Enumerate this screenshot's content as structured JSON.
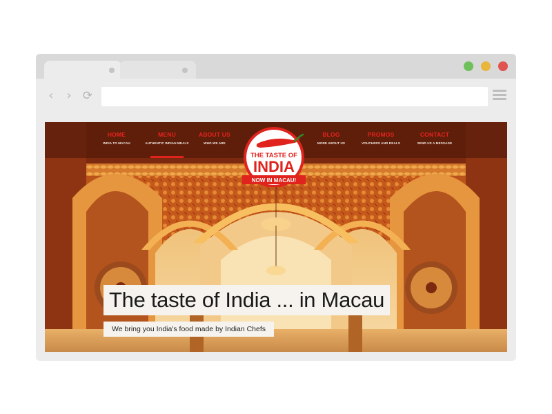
{
  "site": {
    "nav": [
      {
        "label": "HOME",
        "sub": "INDIA TO MACAU"
      },
      {
        "label": "MENU",
        "sub": "AUTHENTIC INDIAN MEALS"
      },
      {
        "label": "ABOUT US",
        "sub": "WHO WE ARE"
      },
      {
        "label": "BLOG",
        "sub": "MORE ABOUT US"
      },
      {
        "label": "PROMOS",
        "sub": "VOUCHERS AND DEALS"
      },
      {
        "label": "CONTACT",
        "sub": "SEND US A MESSAGE"
      }
    ],
    "logo": {
      "line1": "THE TASTE OF",
      "line2": "INDIA",
      "ribbon": "NOW IN MACAU!"
    },
    "hero": {
      "title": "The taste of India ... in Macau",
      "subtitle": "We bring you India's food made by Indian Chefs"
    }
  },
  "icons": {
    "back": "chevron-left-icon",
    "forward": "chevron-right-icon",
    "reload": "reload-icon",
    "menu": "hamburger-menu-icon"
  },
  "colors": {
    "window_controls": [
      "#6ec15a",
      "#e9b53c",
      "#e0534f"
    ],
    "brand_red": "#e0231c"
  }
}
